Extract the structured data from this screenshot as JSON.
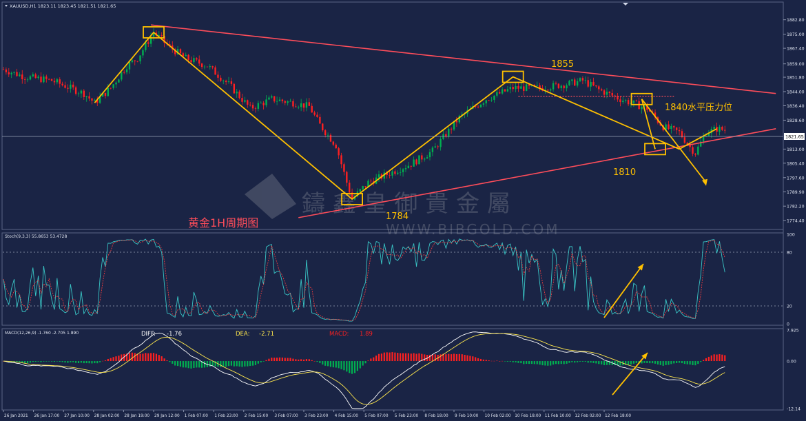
{
  "window": {
    "symbol_header": "XAUUSD,H1  1823.11 1823.45 1821.51 1821.65"
  },
  "colors": {
    "background": "#1a2445",
    "bull": "#00b050",
    "bear": "#ff2020",
    "trend": "#ff4d5a",
    "annotation": "#ffc000",
    "stoch_main": "#39c6c6",
    "stoch_signal": "#ff4040",
    "macd_line": "#ffffff",
    "signal_line": "#ffe84d"
  },
  "watermark": {
    "chinese": "鑄 鑫 皇 御 貴 金 屬",
    "latin": "WWW.BIBGOLD.COM"
  },
  "chart_data": [
    {
      "type": "candlestick",
      "title": "黄金1H周期图",
      "symbol": "XAUUSD",
      "timeframe": "H1",
      "last_price": 1821.65,
      "ylim": [
        1770,
        1889
      ],
      "y_ticks": [
        "1882.80",
        "1875.00",
        "1867.40",
        "1859.00",
        "1851.80",
        "1844.00",
        "1836.40",
        "1828.60",
        "1813.00",
        "1805.40",
        "1797.60",
        "1789.90",
        "1782.20",
        "1774.40"
      ],
      "current_price_label": "1821.65",
      "x_ticks": [
        "26 Jan 2021",
        "26 Jan 17:00",
        "27 Jan 10:00",
        "28 Jan 02:00",
        "28 Jan 19:00",
        "29 Jan 12:00",
        "1 Feb 07:00",
        "1 Feb 23:00",
        "2 Feb 15:00",
        "3 Feb 07:00",
        "3 Feb 23:00",
        "4 Feb 15:00",
        "5 Feb 07:00",
        "5 Feb 23:00",
        "8 Feb 18:00",
        "9 Feb 10:00",
        "10 Feb 02:00",
        "10 Feb 18:00",
        "11 Feb 10:00",
        "12 Feb 02:00",
        "12 Feb 18:00"
      ],
      "price_path": [
        [
          0,
          1856
        ],
        [
          8,
          1852
        ],
        [
          18,
          1850
        ],
        [
          30,
          1843
        ],
        [
          34,
          1838
        ],
        [
          40,
          1846
        ],
        [
          46,
          1858
        ],
        [
          50,
          1862
        ],
        [
          56,
          1876
        ],
        [
          62,
          1868
        ],
        [
          68,
          1862
        ],
        [
          76,
          1858
        ],
        [
          84,
          1848
        ],
        [
          92,
          1835
        ],
        [
          100,
          1840
        ],
        [
          108,
          1838
        ],
        [
          114,
          1836
        ],
        [
          118,
          1826
        ],
        [
          124,
          1815
        ],
        [
          128,
          1795
        ],
        [
          130,
          1786
        ],
        [
          136,
          1795
        ],
        [
          144,
          1800
        ],
        [
          152,
          1805
        ],
        [
          160,
          1812
        ],
        [
          170,
          1830
        ],
        [
          180,
          1840
        ],
        [
          190,
          1846
        ],
        [
          200,
          1846
        ],
        [
          210,
          1848
        ],
        [
          216,
          1850
        ],
        [
          222,
          1845
        ],
        [
          230,
          1840
        ],
        [
          240,
          1835
        ],
        [
          246,
          1825
        ],
        [
          252,
          1822
        ],
        [
          256,
          1814
        ],
        [
          258,
          1811
        ],
        [
          262,
          1822
        ],
        [
          266,
          1824
        ],
        [
          270,
          1823
        ]
      ],
      "trendlines": [
        {
          "name": "resistance",
          "from": [
            55,
            1880
          ],
          "to": [
            288,
            1843
          ]
        },
        {
          "name": "support",
          "from": [
            110,
            1776
          ],
          "to": [
            288,
            1824
          ]
        }
      ],
      "horizontal_level": {
        "price": 1841.5,
        "label": "1840水平压力位"
      },
      "annotations": [
        {
          "text": "1855"
        },
        {
          "text": "1810"
        },
        {
          "text": "1784"
        }
      ]
    },
    {
      "type": "line",
      "title": "Stoch(9,3,3) 55.8653 53.4728",
      "ylim": [
        0,
        100
      ],
      "y_ticks": [
        "100",
        "80",
        "20",
        "0"
      ],
      "levels": [
        80,
        20
      ]
    },
    {
      "type": "bar",
      "title": "MACD(12,26,9) -1.760 -2.705 1.890",
      "legend": [
        {
          "label": "DIFF:",
          "value": "-1.76"
        },
        {
          "label": "DEA:",
          "value": "-2.71"
        },
        {
          "label": "MACD:",
          "value": "1.89"
        }
      ],
      "y_ticks": [
        "7.925",
        "0.00",
        "-12.14"
      ],
      "ylim": [
        -12.14,
        7.925
      ]
    }
  ]
}
